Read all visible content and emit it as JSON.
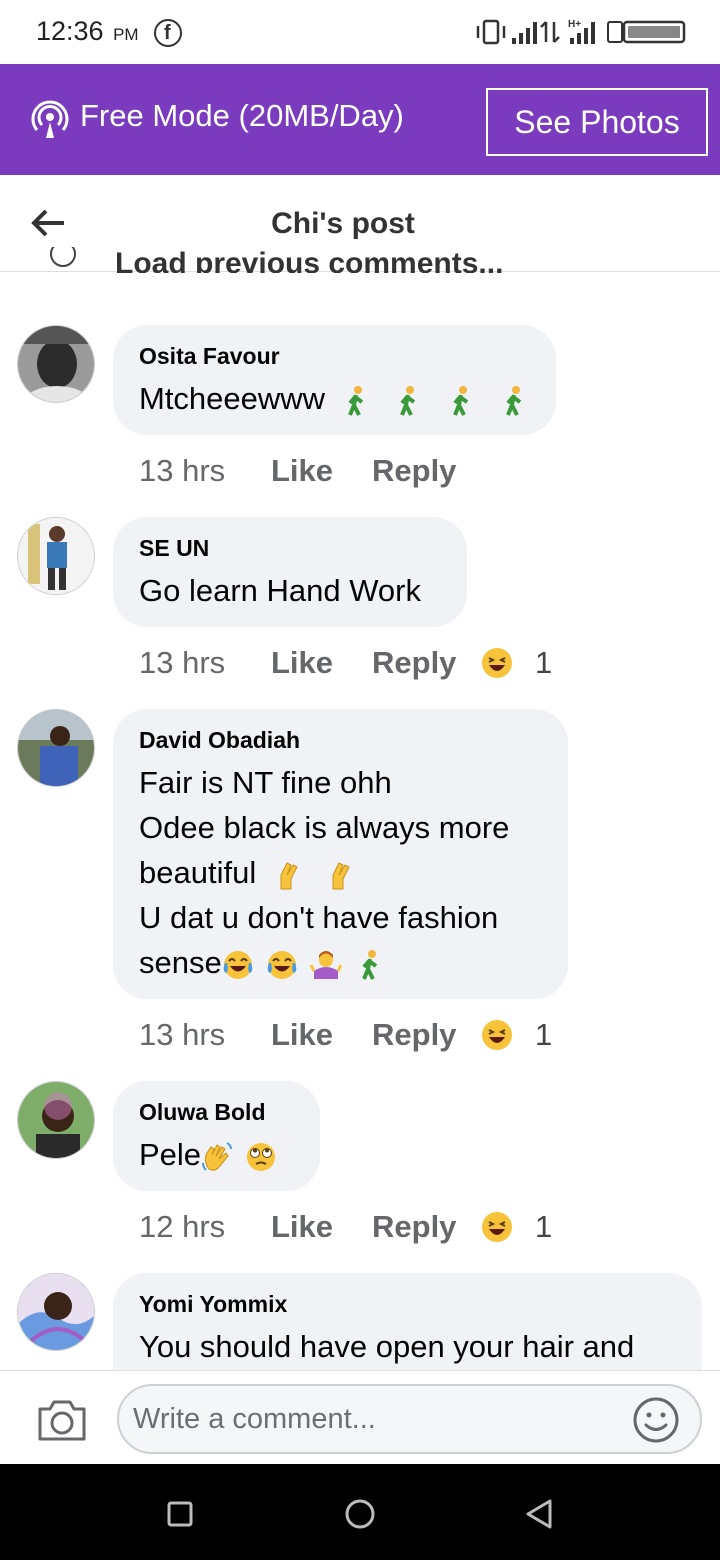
{
  "status_bar": {
    "time": "12:36",
    "ampm": "PM"
  },
  "banner": {
    "mode_text": "Free Mode (20MB/Day)",
    "button_label": "See Photos"
  },
  "header": {
    "title": "Chi's post"
  },
  "load_previous": "Load previous comments...",
  "comments": [
    {
      "author": "Osita Favour",
      "lines": [
        "Mtcheeewww"
      ],
      "time": "13 hrs",
      "like": "Like",
      "reply": "Reply",
      "reaction_count": ""
    },
    {
      "author": "SE UN",
      "lines": [
        "Go learn Hand Work"
      ],
      "time": "13 hrs",
      "like": "Like",
      "reply": "Reply",
      "reaction_count": "1"
    },
    {
      "author": "David Obadiah",
      "lines": [
        "Fair is NT fine ohh",
        "Odee black is always more",
        "beautiful",
        "U dat u don't have fashion",
        "sense"
      ],
      "time": "13 hrs",
      "like": "Like",
      "reply": "Reply",
      "reaction_count": "1"
    },
    {
      "author": "Oluwa Bold",
      "lines": [
        "Pele"
      ],
      "time": "12 hrs",
      "like": "Like",
      "reply": "Reply",
      "reaction_count": "1"
    },
    {
      "author": "Yomi Yommix",
      "lines": [
        "You should have open your hair and"
      ]
    }
  ],
  "input": {
    "placeholder": "Write a comment..."
  },
  "icons": {
    "status": [
      "facebook-icon",
      "vibrate-icon",
      "signal-icon",
      "data-arrows-icon",
      "hplus-signal-icon",
      "battery-icon"
    ],
    "banner": "free-mode-broadcast-icon",
    "header": "back-arrow-icon",
    "input": [
      "camera-icon",
      "smile-icon"
    ],
    "nav": [
      "recents-square-icon",
      "home-circle-icon",
      "back-triangle-icon"
    ]
  },
  "colors": {
    "banner": "#7b3bbf",
    "bubble": "#f0f2f5",
    "meta": "#65676b",
    "nav_bar": "#000000"
  }
}
